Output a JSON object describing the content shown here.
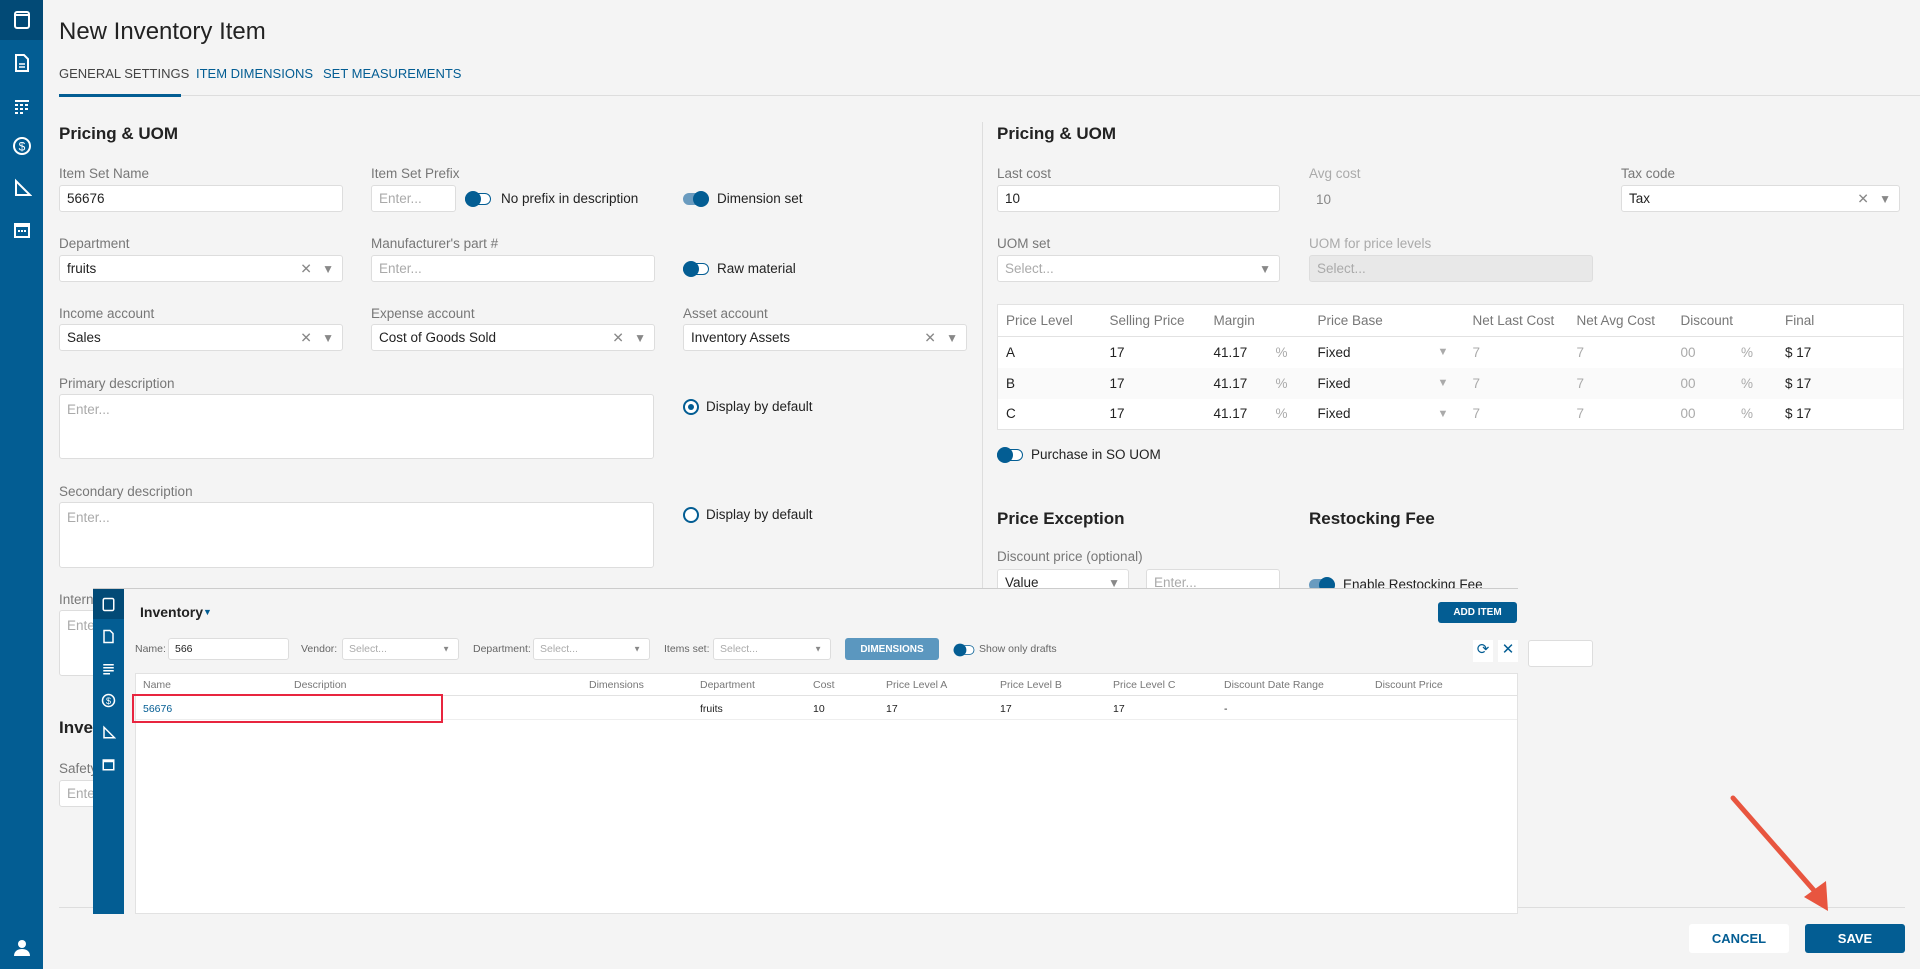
{
  "page": {
    "title": "New Inventory Item",
    "tabs": [
      "GENERAL SETTINGS",
      "ITEM DIMENSIONS",
      "SET MEASUREMENTS"
    ]
  },
  "left": {
    "heading": "Pricing & UOM",
    "item_set_name": {
      "label": "Item Set Name",
      "value": "56676"
    },
    "item_set_prefix": {
      "label": "Item Set Prefix",
      "placeholder": "Enter..."
    },
    "no_prefix": "No prefix in description",
    "dimension_set": "Dimension set",
    "department": {
      "label": "Department",
      "value": "fruits"
    },
    "manufacturer_part": {
      "label": "Manufacturer's part #",
      "placeholder": "Enter..."
    },
    "raw_material": "Raw material",
    "income_account": {
      "label": "Income account",
      "value": "Sales"
    },
    "expense_account": {
      "label": "Expense account",
      "value": "Cost of Goods Sold"
    },
    "asset_account": {
      "label": "Asset account",
      "value": "Inventory Assets"
    },
    "primary_description": {
      "label": "Primary description",
      "placeholder": "Enter..."
    },
    "display_default_1": "Display by default",
    "secondary_description": {
      "label": "Secondary description",
      "placeholder": "Enter..."
    },
    "display_default_2": "Display by default",
    "internal_label": "Intern",
    "internal_placeholder": "Ente",
    "inventory_heading": "Inven",
    "safety_label": "Safety",
    "safety_placeholder": "Ente"
  },
  "right": {
    "heading": "Pricing & UOM",
    "last_cost": {
      "label": "Last cost",
      "value": "10"
    },
    "avg_cost": {
      "label": "Avg cost",
      "value": "10"
    },
    "tax_code": {
      "label": "Tax code",
      "value": "Tax"
    },
    "uom_set": {
      "label": "UOM set",
      "placeholder": "Select..."
    },
    "uom_price_levels": {
      "label": "UOM for price levels",
      "placeholder": "Select..."
    },
    "price_table": {
      "headers": [
        "Price Level",
        "Selling Price",
        "Margin",
        "",
        "Price Base",
        "",
        "Net Last Cost",
        "Net Avg Cost",
        "Discount",
        "",
        "Final"
      ],
      "rows": [
        {
          "level": "A",
          "selling": "17",
          "margin": "41.17",
          "pct": "%",
          "base": "Fixed",
          "net_last": "7",
          "net_avg": "7",
          "discount": "00",
          "dpct": "%",
          "final": "$ 17"
        },
        {
          "level": "B",
          "selling": "17",
          "margin": "41.17",
          "pct": "%",
          "base": "Fixed",
          "net_last": "7",
          "net_avg": "7",
          "discount": "00",
          "dpct": "%",
          "final": "$ 17"
        },
        {
          "level": "C",
          "selling": "17",
          "margin": "41.17",
          "pct": "%",
          "base": "Fixed",
          "net_last": "7",
          "net_avg": "7",
          "discount": "00",
          "dpct": "%",
          "final": "$ 17"
        }
      ]
    },
    "purchase_so_uom": "Purchase in SO UOM",
    "price_exception": "Price Exception",
    "restocking_fee": "Restocking Fee",
    "discount_price": {
      "label": "Discount price (optional)",
      "type": "Value",
      "placeholder": "Enter..."
    },
    "enable_restocking": "Enable Restocking Fee"
  },
  "footer": {
    "cancel": "CANCEL",
    "save": "SAVE"
  },
  "popup": {
    "title": "Inventory",
    "add_item": "ADD ITEM",
    "filters": {
      "name_label": "Name:",
      "name_value": "566",
      "vendor_label": "Vendor:",
      "vendor_placeholder": "Select...",
      "department_label": "Department:",
      "department_placeholder": "Select...",
      "items_set_label": "Items set:",
      "items_set_placeholder": "Select...",
      "dimensions": "DIMENSIONS",
      "show_drafts": "Show only drafts"
    },
    "columns": [
      "Name",
      "Description",
      "Dimensions",
      "Department",
      "Cost",
      "Price Level A",
      "Price Level B",
      "Price Level C",
      "Discount Date Range",
      "Discount Price"
    ],
    "rows": [
      {
        "name": "56676",
        "description": "",
        "dimensions": "",
        "department": "fruits",
        "cost": "10",
        "pla": "17",
        "plb": "17",
        "plc": "17",
        "ddr": "-",
        "dp": ""
      }
    ]
  },
  "colors": {
    "primary": "#035d93",
    "highlight": "#e8253f",
    "arrow": "#e8553f"
  }
}
